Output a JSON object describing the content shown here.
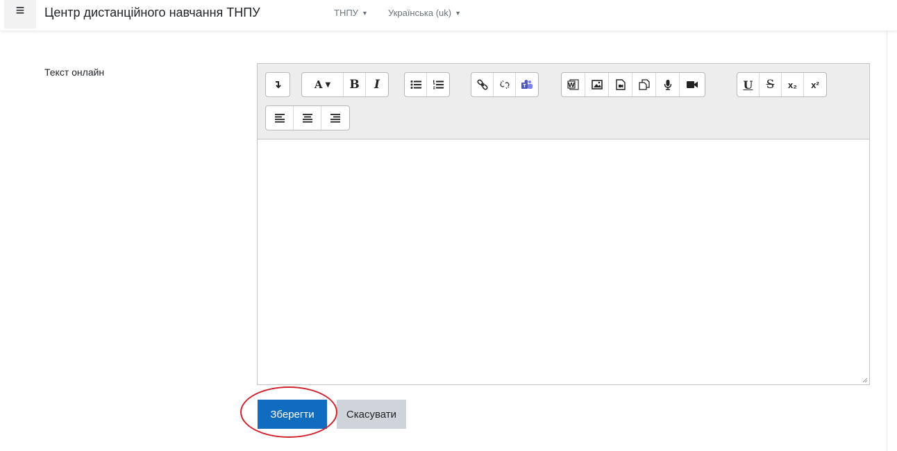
{
  "nav": {
    "site_name": "Центр дистанційного навчання ТНПУ",
    "menu1": "ТНПУ",
    "menu2": "Українська (uk)"
  },
  "form": {
    "field_label": "Текст онлайн",
    "save_label": "Зберегти",
    "cancel_label": "Скасувати",
    "content": ""
  },
  "toolbar": {
    "font_color_label": "A",
    "bold_label": "B",
    "italic_label": "I",
    "underline_label": "U",
    "strike_label": "S",
    "subscript_label": "x₂",
    "superscript_label": "x²"
  },
  "colors": {
    "primary": "#0f6cbf",
    "secondary": "#ced4da",
    "annotation": "#d0202a"
  }
}
